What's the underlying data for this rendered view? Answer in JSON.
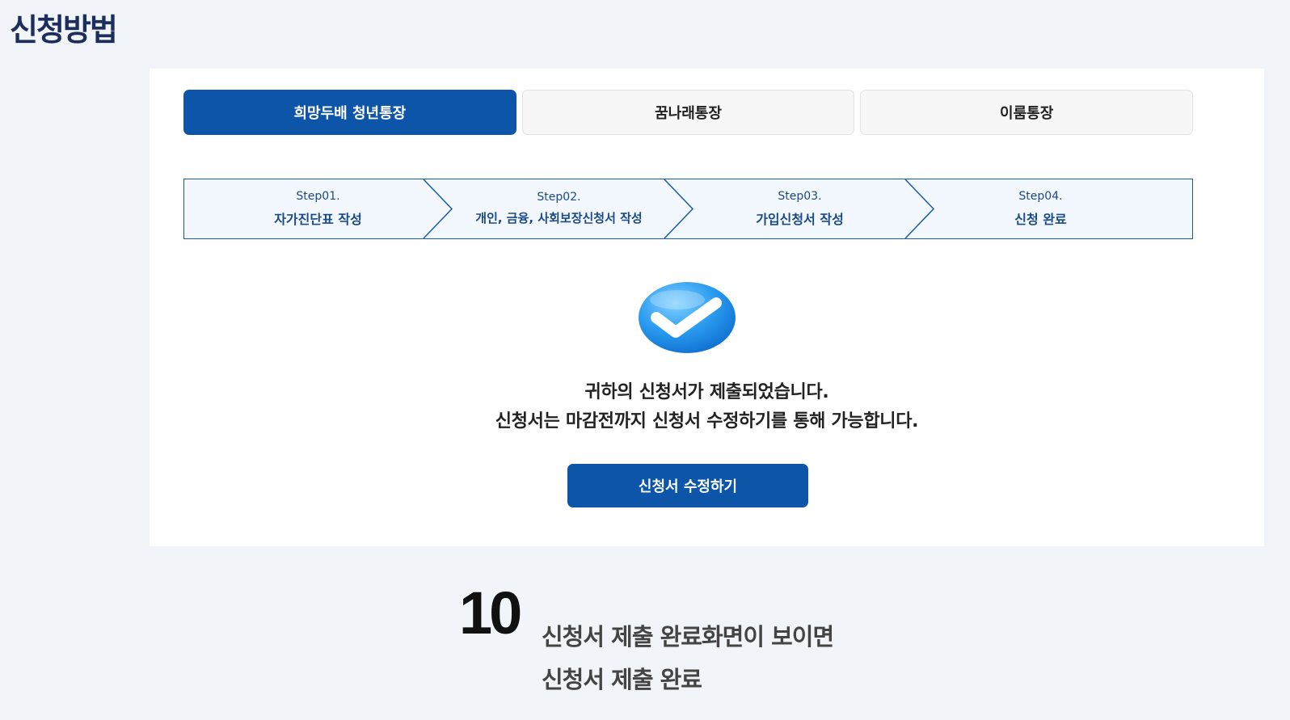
{
  "page": {
    "heading": "신청방법"
  },
  "tabs": [
    {
      "label": "희망두배 청년통장",
      "active": true
    },
    {
      "label": "꿈나래통장",
      "active": false
    },
    {
      "label": "이룸통장",
      "active": false
    }
  ],
  "steps": [
    {
      "num": "Step01.",
      "label": "자가진단표 작성"
    },
    {
      "num": "Step02.",
      "label": "개인, 금융, 사회보장신청서 작성"
    },
    {
      "num": "Step03.",
      "label": "가입신청서 작성"
    },
    {
      "num": "Step04.",
      "label": "신청 완료"
    }
  ],
  "completion": {
    "icon": "check-circle-icon",
    "line1": "귀하의 신청서가 제출되었습니다.",
    "line2": "신청서는 마감전까지 신청서 수정하기를 통해 가능합니다.",
    "button_label": "신청서 수정하기"
  },
  "instruction": {
    "step_number": "10",
    "line1": "신청서 제출 완료화면이 보이면",
    "line2": "신청서 제출 완료"
  },
  "colors": {
    "primary": "#0d55a8",
    "heading": "#1c2f5c",
    "step_border": "#1a5aa8",
    "step_bg": "#f2f8fe",
    "page_bg": "#f1f4f8"
  }
}
